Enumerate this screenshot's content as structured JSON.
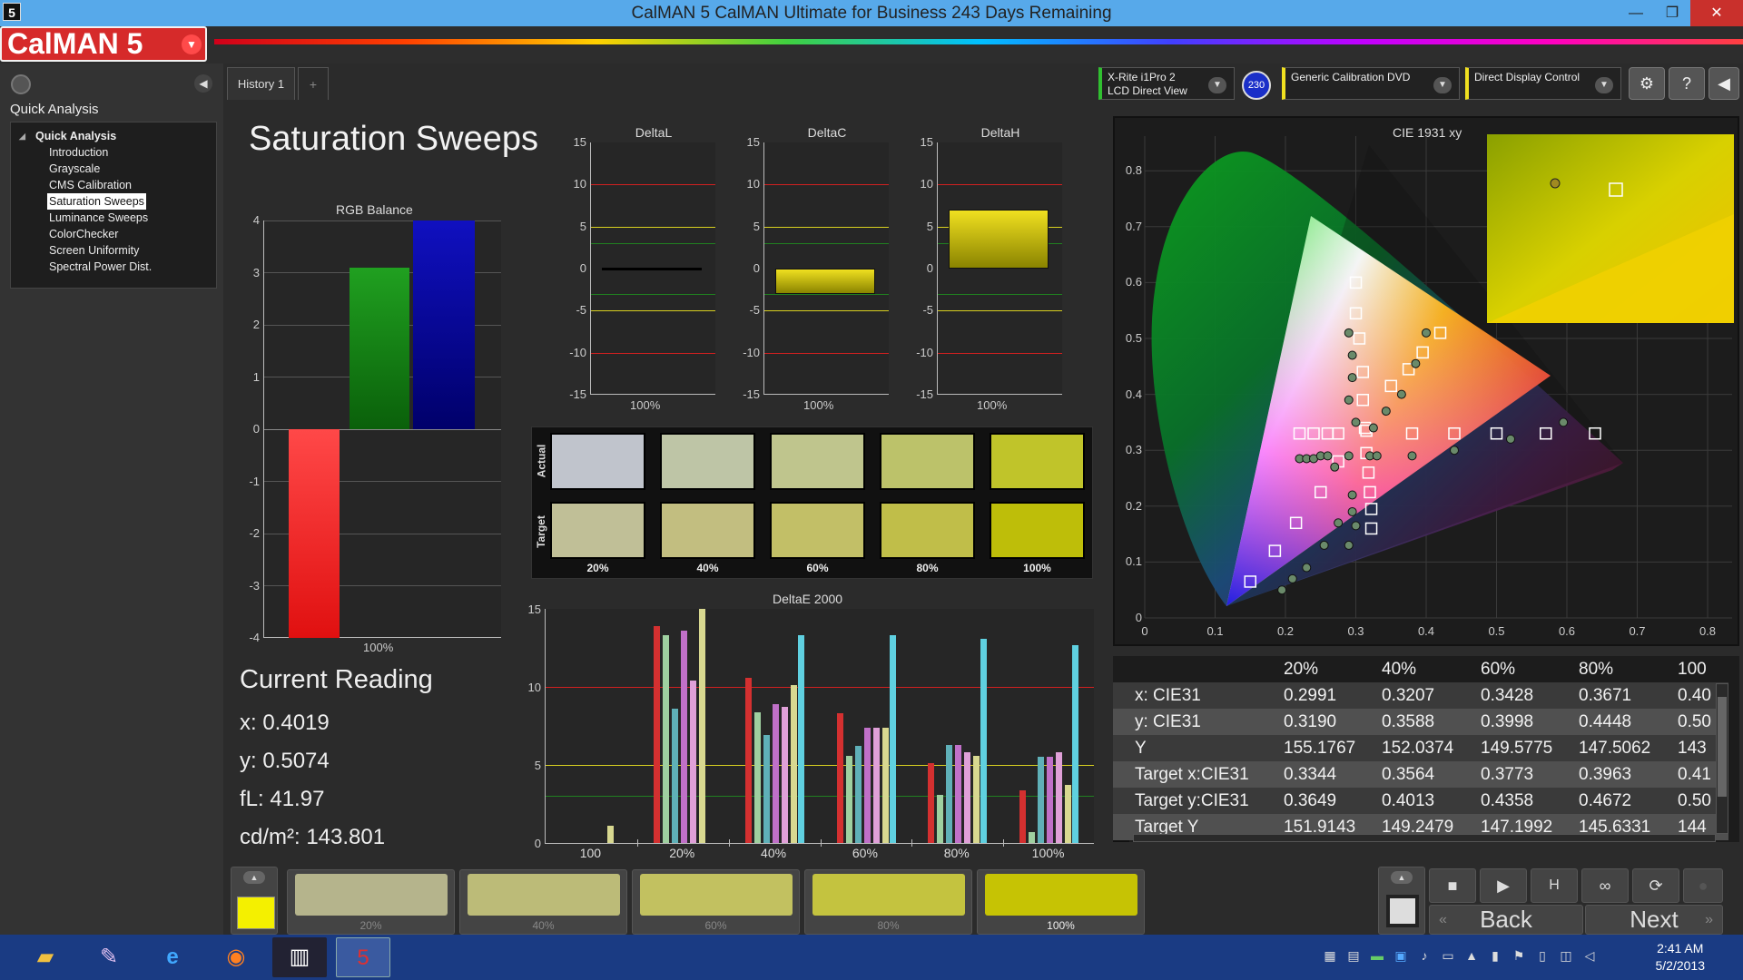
{
  "window": {
    "title": "CalMAN 5 CalMAN Ultimate for Business 243 Days Remaining",
    "app_icon": "5",
    "minimize": "—",
    "restore": "❐",
    "close": "✕"
  },
  "brand": {
    "logo": "CalMAN 5",
    "logo_arrow": "▼"
  },
  "sidebar": {
    "title": "Quick Analysis",
    "tree_root": "Quick Analysis",
    "items": [
      "Introduction",
      "Grayscale",
      "CMS Calibration",
      "Saturation Sweeps",
      "Luminance Sweeps",
      "ColorChecker",
      "Screen Uniformity",
      "Spectral Power Dist."
    ],
    "selected": "Saturation Sweeps"
  },
  "tabs": {
    "history": "History 1",
    "add": "+"
  },
  "devices": {
    "meter_line1": "X-Rite i1Pro 2",
    "meter_line2": "LCD Direct View",
    "meter_badge": "230",
    "source": "Generic Calibration DVD",
    "display": "Direct Display Control"
  },
  "page": {
    "title": "Saturation Sweeps"
  },
  "rgb_balance": {
    "title": "RGB Balance",
    "x_label": "100%",
    "yticks": [
      "4",
      "3",
      "2",
      "1",
      "0",
      "-1",
      "-2",
      "-3",
      "-4"
    ],
    "red": -4.0,
    "green": 3.1,
    "blue": 4.0
  },
  "delta_charts": {
    "titles": [
      "DeltaL",
      "DeltaC",
      "DeltaH"
    ],
    "x_label": "100%",
    "yticks": [
      "15",
      "10",
      "5",
      "0",
      "-5",
      "-10",
      "-15"
    ],
    "values": [
      0.0,
      -3.0,
      7.0
    ]
  },
  "swatches": {
    "actual_label": "Actual",
    "target_label": "Target",
    "labels": [
      "20%",
      "40%",
      "60%",
      "80%",
      "100%"
    ],
    "actual": [
      "#c0c4cc",
      "#bec5a6",
      "#bfc58d",
      "#bcc26a",
      "#c0c42a"
    ],
    "target": [
      "#c0bf97",
      "#c2be80",
      "#c2bf67",
      "#c0be49",
      "#bebe09"
    ]
  },
  "chart_data": {
    "type": "bar",
    "title": "DeltaE 2000",
    "categories": [
      "100",
      "20%",
      "40%",
      "60%",
      "80%",
      "100%"
    ],
    "ylim": [
      0,
      15
    ],
    "yticks": [
      "15",
      "10",
      "5",
      "0"
    ],
    "series": [
      {
        "color": "#d43030",
        "values": [
          0,
          13.9,
          10.6,
          8.3,
          5.1,
          3.4
        ]
      },
      {
        "color": "#9fd0a0",
        "values": [
          0,
          13.3,
          8.4,
          5.6,
          3.1,
          0.7
        ]
      },
      {
        "color": "#5fb0b8",
        "values": [
          0,
          8.6,
          6.9,
          6.2,
          6.3,
          5.5
        ]
      },
      {
        "color": "#c070c8",
        "values": [
          0,
          13.6,
          8.9,
          7.4,
          6.3,
          5.5
        ]
      },
      {
        "color": "#e0a0d8",
        "values": [
          0,
          10.4,
          8.7,
          7.4,
          5.8,
          5.8
        ]
      },
      {
        "color": "#d8d890",
        "values": [
          1.1,
          15.0,
          10.1,
          7.4,
          5.6,
          3.7
        ]
      }
    ],
    "secondary": {
      "color": "#5fd0e0",
      "values": [
        0,
        0,
        13.3,
        13.3,
        13.1,
        12.7
      ]
    }
  },
  "cie": {
    "title": "CIE 1931 xy",
    "xticks": [
      "0",
      "0.1",
      "0.2",
      "0.3",
      "0.4",
      "0.5",
      "0.6",
      "0.7",
      "0.8"
    ],
    "yticks": [
      "0.8",
      "0.7",
      "0.6",
      "0.5",
      "0.4",
      "0.3",
      "0.2",
      "0.1",
      "0"
    ]
  },
  "current_reading": {
    "title": "Current Reading",
    "x": "x: 0.4019",
    "y": "y: 0.5074",
    "fl": "fL: 41.97",
    "cdm2": "cd/m²: 143.801"
  },
  "table": {
    "headers": [
      "20%",
      "40%",
      "60%",
      "80%",
      "100"
    ],
    "rows": [
      {
        "label": "x: CIE31",
        "values": [
          "0.2991",
          "0.3207",
          "0.3428",
          "0.3671",
          "0.40"
        ]
      },
      {
        "label": "y: CIE31",
        "values": [
          "0.3190",
          "0.3588",
          "0.3998",
          "0.4448",
          "0.50"
        ]
      },
      {
        "label": "Y",
        "values": [
          "155.1767",
          "152.0374",
          "149.5775",
          "147.5062",
          "143"
        ]
      },
      {
        "label": "Target x:CIE31",
        "values": [
          "0.3344",
          "0.3564",
          "0.3773",
          "0.3963",
          "0.41"
        ]
      },
      {
        "label": "Target y:CIE31",
        "values": [
          "0.3649",
          "0.4013",
          "0.4358",
          "0.4672",
          "0.50"
        ]
      },
      {
        "label": "Target Y",
        "values": [
          "151.9143",
          "149.2479",
          "147.1992",
          "145.6331",
          "144"
        ]
      }
    ]
  },
  "bottom": {
    "swatch_labels": [
      "20%",
      "40%",
      "60%",
      "80%",
      "100%"
    ],
    "swatch_colors": [
      "#b5b48c",
      "#bcbb78",
      "#c2c160",
      "#c4c33f",
      "#c6c304"
    ],
    "current_color": "#f4f000",
    "back": "Back",
    "next": "Next"
  },
  "taskbar": {
    "time": "2:41 AM",
    "date": "5/2/2013"
  }
}
